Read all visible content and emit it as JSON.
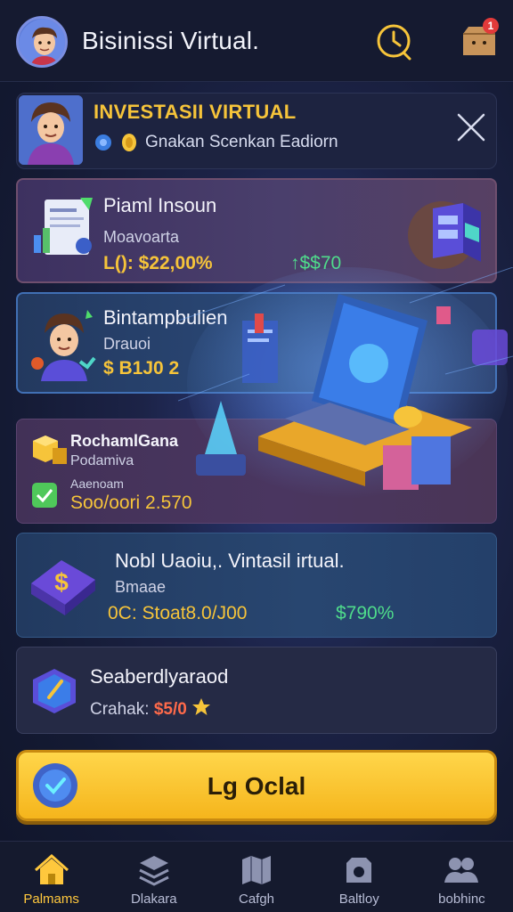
{
  "header": {
    "title": "Bisinissi Virtual.",
    "notification_count": "1"
  },
  "banner": {
    "title": "INVESTASII VIRTUAL",
    "subtitle": "Gnakan Scenkan Eadiorn"
  },
  "cards": [
    {
      "title": "Piaml Insoun",
      "subtitle": "Moavoarta",
      "value": "L(): $22,00%",
      "change": "↑$$70"
    },
    {
      "title": "Bintampbulien",
      "subtitle": "Drauoi",
      "value": "$ B1J0 2"
    },
    {
      "title": "RochamlGana",
      "subtitle": "Podamiva",
      "label": "Aaenoam",
      "value": "Soo/oori 2.570"
    },
    {
      "title": "Nobl Uaoiu,. Vintasil irtual.",
      "subtitle": "Bmaae",
      "value": "0C: Stoat8.0/J00",
      "change": "$790%"
    },
    {
      "title": "Seaberdlyaraod",
      "meta_label": "Crahak:",
      "meta_value": "$5/0"
    }
  ],
  "cta": {
    "label": "Lg Oclal"
  },
  "tabs": [
    {
      "label": "Palmams",
      "active": true
    },
    {
      "label": "Dlakara"
    },
    {
      "label": "Cafgh"
    },
    {
      "label": "Baltloy"
    },
    {
      "label": "bobhinc"
    }
  ],
  "colors": {
    "accent": "#f6c43a",
    "positive": "#4fdc8b",
    "negative": "#ff6a4a",
    "background": "#141a33"
  }
}
